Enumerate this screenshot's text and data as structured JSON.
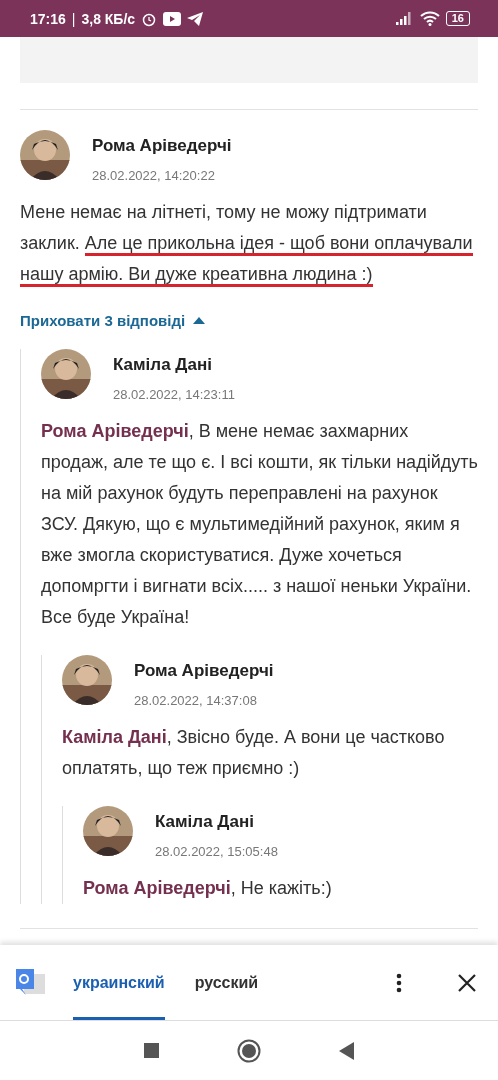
{
  "status_bar": {
    "time": "17:16",
    "separator": "|",
    "speed": "3,8 КБ/с",
    "battery": "16"
  },
  "comment": {
    "author": "Рома Аріведерчі",
    "date": "28.02.2022, 14:20:22",
    "body": [
      {
        "text": "Мене немає на літнеті, тому не можу підтримати заклик. ",
        "underlined": false
      },
      {
        "text": "Але це прикольна ідея - щоб вони оплачували нашу армію. Ви дуже креативна людина :)",
        "underlined": true
      }
    ],
    "replies_toggle": {
      "label": "Приховати 3 відповіді",
      "expanded": true
    },
    "children": [
      {
        "author": "Каміла Дані",
        "date": "28.02.2022, 14:23:11",
        "mention": "Рома Аріведерчі",
        "text": ", В мене немає захмарних продаж, але те що є. І всі кошти, як тільки надійдуть на мій рахунок будуть переправлені на рахунок ЗСУ. Дякую, що є мультимедійний рахунок, яким я вже змогла скористуватися. Дуже хочеться допомргти і вигнати всіх..... з нашої неньки України. Все буде Україна!",
        "children": [
          {
            "author": "Рома Аріведерчі",
            "date": "28.02.2022, 14:37:08",
            "mention": "Каміла Дані",
            "text": ", Звісно буде. А вони це частково оплатять, що теж приємно :)",
            "children": [
              {
                "author": "Каміла Дані",
                "date": "28.02.2022, 15:05:48",
                "mention": "Рома Аріведерчі",
                "text": ", Не кажіть:)"
              }
            ]
          }
        ]
      }
    ]
  },
  "translate_bar": {
    "tabs": [
      {
        "label": "украинский",
        "selected": true
      },
      {
        "label": "русский",
        "selected": false
      }
    ]
  }
}
